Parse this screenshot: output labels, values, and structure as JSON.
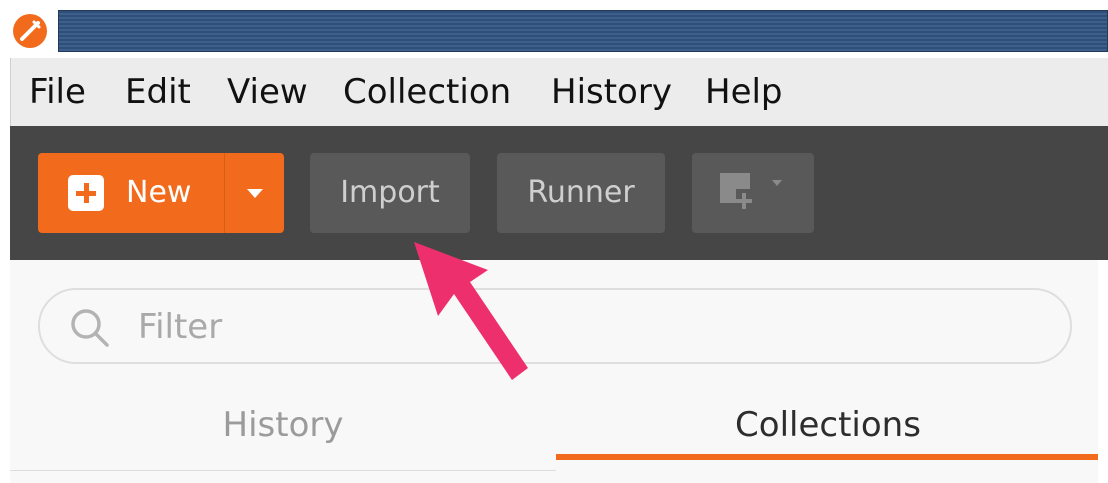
{
  "titlebar": {
    "logo_icon": "postman-logo-icon"
  },
  "menu": {
    "items": [
      {
        "label": "File"
      },
      {
        "label": "Edit"
      },
      {
        "label": "View"
      },
      {
        "label": "Collection"
      },
      {
        "label": "History"
      },
      {
        "label": "Help"
      }
    ]
  },
  "toolbar": {
    "new_label": "New",
    "new_icon": "plus-square-icon",
    "dropdown_icon": "caret-down-icon",
    "import_label": "Import",
    "runner_label": "Runner",
    "workspace_icon": "new-window-icon"
  },
  "sidebar": {
    "filter_placeholder": "Filter",
    "tabs": [
      {
        "label": "History",
        "active": false
      },
      {
        "label": "Collections",
        "active": true
      }
    ]
  },
  "annotation": {
    "icon": "pointer-arrow-icon",
    "color": "#ee2f6e"
  },
  "colors": {
    "accent": "#f26b1d",
    "toolbar_bg": "#464646",
    "button_bg": "#595959"
  }
}
